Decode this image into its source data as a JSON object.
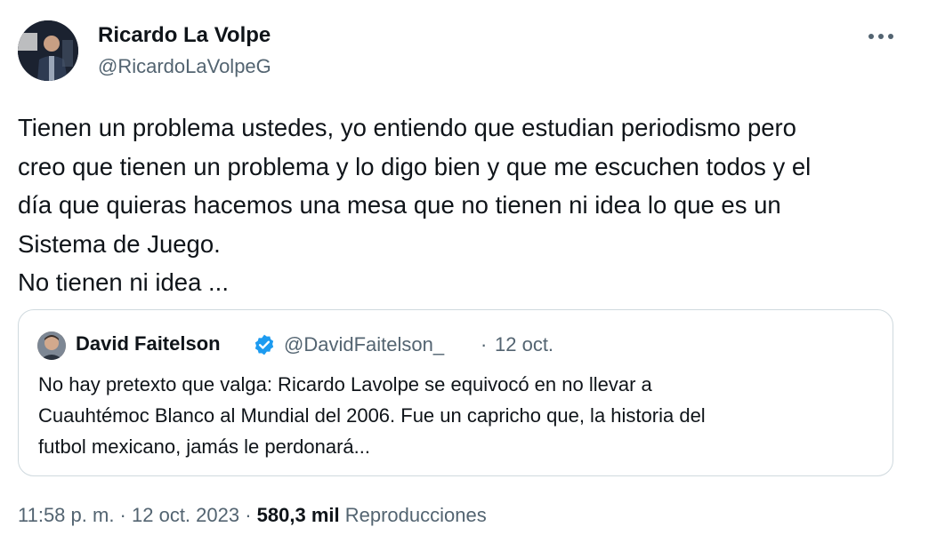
{
  "author": {
    "name": "Ricardo La Volpe",
    "handle": "@RicardoLaVolpeG"
  },
  "menu": {
    "icon": "more-horizontal-icon"
  },
  "tweet": {
    "lines": [
      "Tienen un problema ustedes, yo entiendo que estudian periodismo pero",
      "creo que tienen un problema y lo digo bien y que me escuchen todos y el",
      "día que quieras hacemos una mesa que no tienen ni idea lo que es un",
      "Sistema de Juego.",
      "No tienen ni idea ..."
    ]
  },
  "quote": {
    "name": "David Faitelson",
    "verified_icon": "verified-badge-icon",
    "handle": "@DavidFaitelson_",
    "separator": "·",
    "date": "12 oct.",
    "lines": [
      "No hay pretexto que valga: Ricardo Lavolpe se equivocó en no llevar a",
      "Cuauhtémoc Blanco al Mundial del 2006. Fue un capricho que, la historia del",
      "futbol mexicano, jamás le perdonará..."
    ]
  },
  "meta": {
    "time": "11:58 p. m.",
    "sep1": " · ",
    "date": "12 oct. 2023",
    "sep2": " · ",
    "views_count": "580,3 mil",
    "views_label": " Reproducciones"
  },
  "colors": {
    "text": "#0f1419",
    "secondary": "#536471",
    "border": "#cfd9de",
    "verified": "#1d9bf0"
  }
}
